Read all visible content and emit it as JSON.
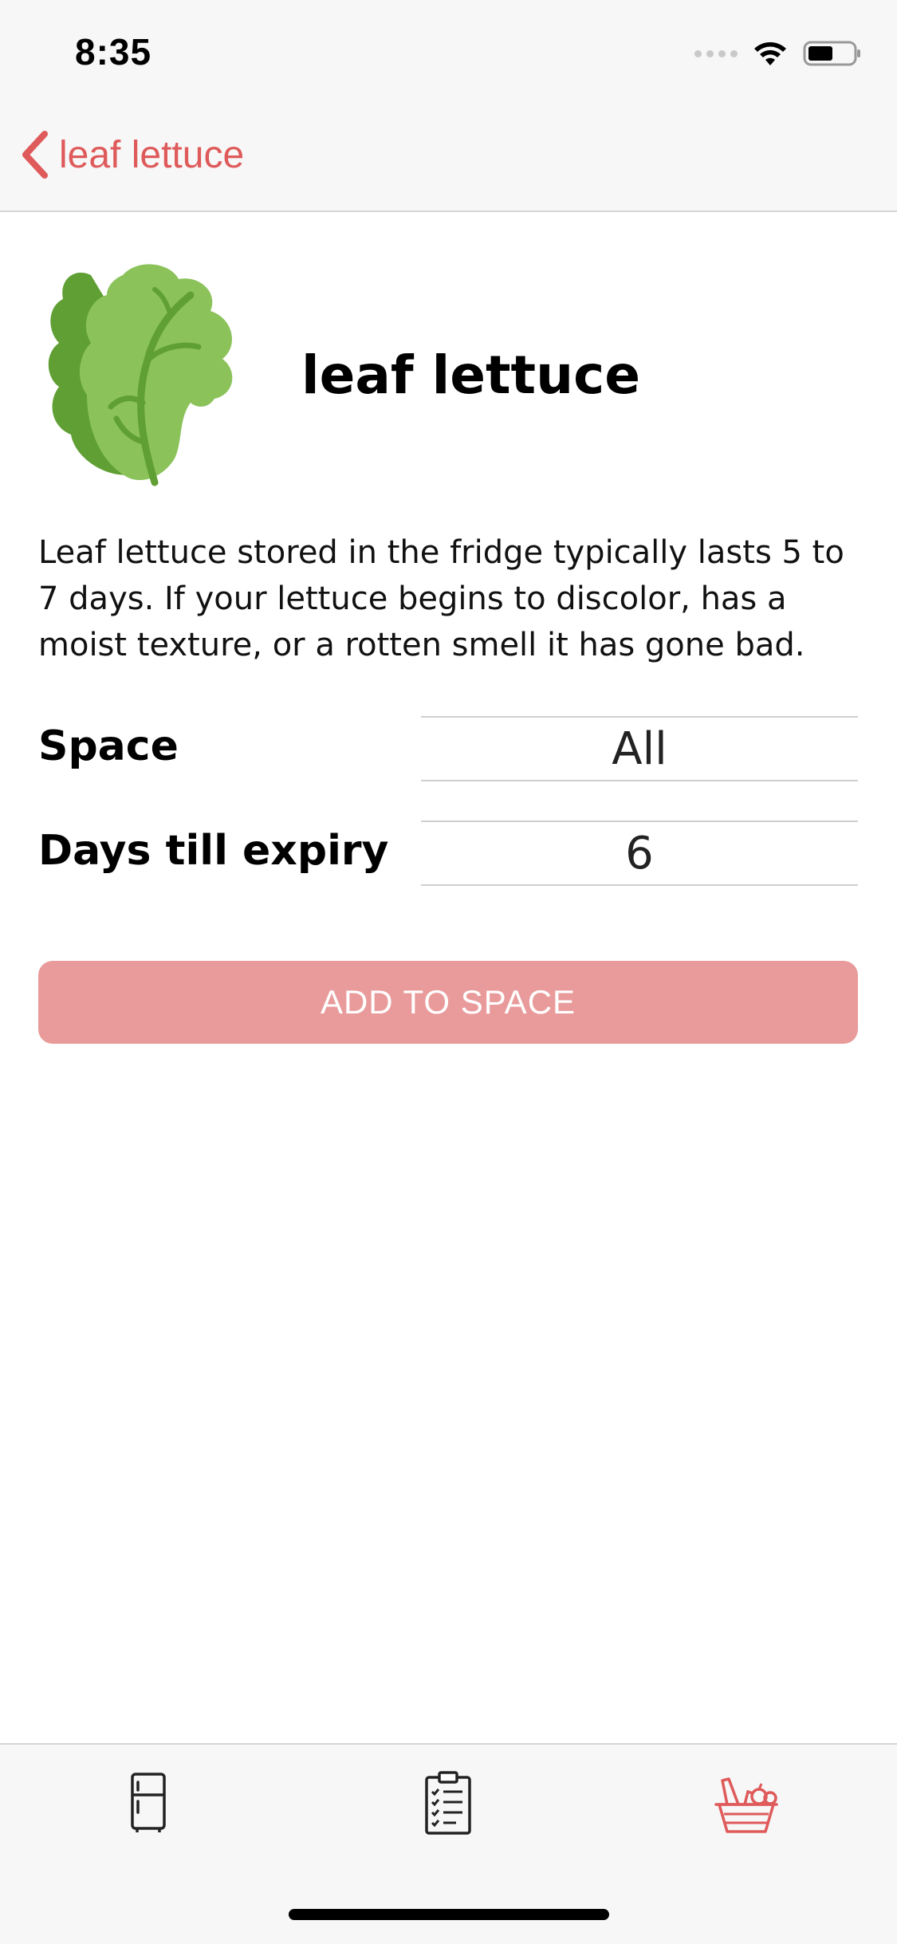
{
  "status_bar": {
    "time": "8:35",
    "icons": [
      "signal-dots-icon",
      "wifi-icon",
      "battery-icon"
    ]
  },
  "nav": {
    "back_label": "leaf lettuce",
    "accent_color": "#df5a5a"
  },
  "item": {
    "name": "leaf lettuce",
    "icon": "lettuce-icon",
    "description": "Leaf lettuce stored in the fridge typically lasts 5 to 7 days.  If your lettuce begins to discolor, has a moist texture, or a rotten smell it has gone bad."
  },
  "fields": {
    "space_label": "Space",
    "space_value": "All",
    "expiry_label": "Days till expiry",
    "expiry_value": "6"
  },
  "actions": {
    "add_label": "ADD TO SPACE",
    "add_color": "#e99b9b"
  },
  "tab_bar": {
    "tabs": [
      {
        "icon": "fridge-icon",
        "active": false
      },
      {
        "icon": "clipboard-checklist-icon",
        "active": false
      },
      {
        "icon": "basket-icon",
        "active": true
      }
    ]
  }
}
